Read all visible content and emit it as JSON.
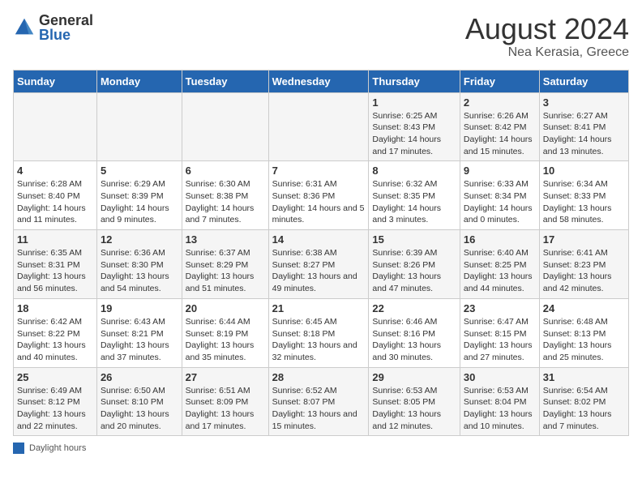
{
  "header": {
    "logo_general": "General",
    "logo_blue": "Blue",
    "title": "August 2024",
    "subtitle": "Nea Kerasia, Greece"
  },
  "days_of_week": [
    "Sunday",
    "Monday",
    "Tuesday",
    "Wednesday",
    "Thursday",
    "Friday",
    "Saturday"
  ],
  "legend": {
    "label": "Daylight hours"
  },
  "weeks": [
    [
      {
        "num": "",
        "info": ""
      },
      {
        "num": "",
        "info": ""
      },
      {
        "num": "",
        "info": ""
      },
      {
        "num": "",
        "info": ""
      },
      {
        "num": "1",
        "info": "Sunrise: 6:25 AM\nSunset: 8:43 PM\nDaylight: 14 hours\nand 17 minutes."
      },
      {
        "num": "2",
        "info": "Sunrise: 6:26 AM\nSunset: 8:42 PM\nDaylight: 14 hours\nand 15 minutes."
      },
      {
        "num": "3",
        "info": "Sunrise: 6:27 AM\nSunset: 8:41 PM\nDaylight: 14 hours\nand 13 minutes."
      }
    ],
    [
      {
        "num": "4",
        "info": "Sunrise: 6:28 AM\nSunset: 8:40 PM\nDaylight: 14 hours\nand 11 minutes."
      },
      {
        "num": "5",
        "info": "Sunrise: 6:29 AM\nSunset: 8:39 PM\nDaylight: 14 hours\nand 9 minutes."
      },
      {
        "num": "6",
        "info": "Sunrise: 6:30 AM\nSunset: 8:38 PM\nDaylight: 14 hours\nand 7 minutes."
      },
      {
        "num": "7",
        "info": "Sunrise: 6:31 AM\nSunset: 8:36 PM\nDaylight: 14 hours\nand 5 minutes."
      },
      {
        "num": "8",
        "info": "Sunrise: 6:32 AM\nSunset: 8:35 PM\nDaylight: 14 hours\nand 3 minutes."
      },
      {
        "num": "9",
        "info": "Sunrise: 6:33 AM\nSunset: 8:34 PM\nDaylight: 14 hours\nand 0 minutes."
      },
      {
        "num": "10",
        "info": "Sunrise: 6:34 AM\nSunset: 8:33 PM\nDaylight: 13 hours\nand 58 minutes."
      }
    ],
    [
      {
        "num": "11",
        "info": "Sunrise: 6:35 AM\nSunset: 8:31 PM\nDaylight: 13 hours\nand 56 minutes."
      },
      {
        "num": "12",
        "info": "Sunrise: 6:36 AM\nSunset: 8:30 PM\nDaylight: 13 hours\nand 54 minutes."
      },
      {
        "num": "13",
        "info": "Sunrise: 6:37 AM\nSunset: 8:29 PM\nDaylight: 13 hours\nand 51 minutes."
      },
      {
        "num": "14",
        "info": "Sunrise: 6:38 AM\nSunset: 8:27 PM\nDaylight: 13 hours\nand 49 minutes."
      },
      {
        "num": "15",
        "info": "Sunrise: 6:39 AM\nSunset: 8:26 PM\nDaylight: 13 hours\nand 47 minutes."
      },
      {
        "num": "16",
        "info": "Sunrise: 6:40 AM\nSunset: 8:25 PM\nDaylight: 13 hours\nand 44 minutes."
      },
      {
        "num": "17",
        "info": "Sunrise: 6:41 AM\nSunset: 8:23 PM\nDaylight: 13 hours\nand 42 minutes."
      }
    ],
    [
      {
        "num": "18",
        "info": "Sunrise: 6:42 AM\nSunset: 8:22 PM\nDaylight: 13 hours\nand 40 minutes."
      },
      {
        "num": "19",
        "info": "Sunrise: 6:43 AM\nSunset: 8:21 PM\nDaylight: 13 hours\nand 37 minutes."
      },
      {
        "num": "20",
        "info": "Sunrise: 6:44 AM\nSunset: 8:19 PM\nDaylight: 13 hours\nand 35 minutes."
      },
      {
        "num": "21",
        "info": "Sunrise: 6:45 AM\nSunset: 8:18 PM\nDaylight: 13 hours\nand 32 minutes."
      },
      {
        "num": "22",
        "info": "Sunrise: 6:46 AM\nSunset: 8:16 PM\nDaylight: 13 hours\nand 30 minutes."
      },
      {
        "num": "23",
        "info": "Sunrise: 6:47 AM\nSunset: 8:15 PM\nDaylight: 13 hours\nand 27 minutes."
      },
      {
        "num": "24",
        "info": "Sunrise: 6:48 AM\nSunset: 8:13 PM\nDaylight: 13 hours\nand 25 minutes."
      }
    ],
    [
      {
        "num": "25",
        "info": "Sunrise: 6:49 AM\nSunset: 8:12 PM\nDaylight: 13 hours\nand 22 minutes."
      },
      {
        "num": "26",
        "info": "Sunrise: 6:50 AM\nSunset: 8:10 PM\nDaylight: 13 hours\nand 20 minutes."
      },
      {
        "num": "27",
        "info": "Sunrise: 6:51 AM\nSunset: 8:09 PM\nDaylight: 13 hours\nand 17 minutes."
      },
      {
        "num": "28",
        "info": "Sunrise: 6:52 AM\nSunset: 8:07 PM\nDaylight: 13 hours\nand 15 minutes."
      },
      {
        "num": "29",
        "info": "Sunrise: 6:53 AM\nSunset: 8:05 PM\nDaylight: 13 hours\nand 12 minutes."
      },
      {
        "num": "30",
        "info": "Sunrise: 6:53 AM\nSunset: 8:04 PM\nDaylight: 13 hours\nand 10 minutes."
      },
      {
        "num": "31",
        "info": "Sunrise: 6:54 AM\nSunset: 8:02 PM\nDaylight: 13 hours\nand 7 minutes."
      }
    ]
  ]
}
